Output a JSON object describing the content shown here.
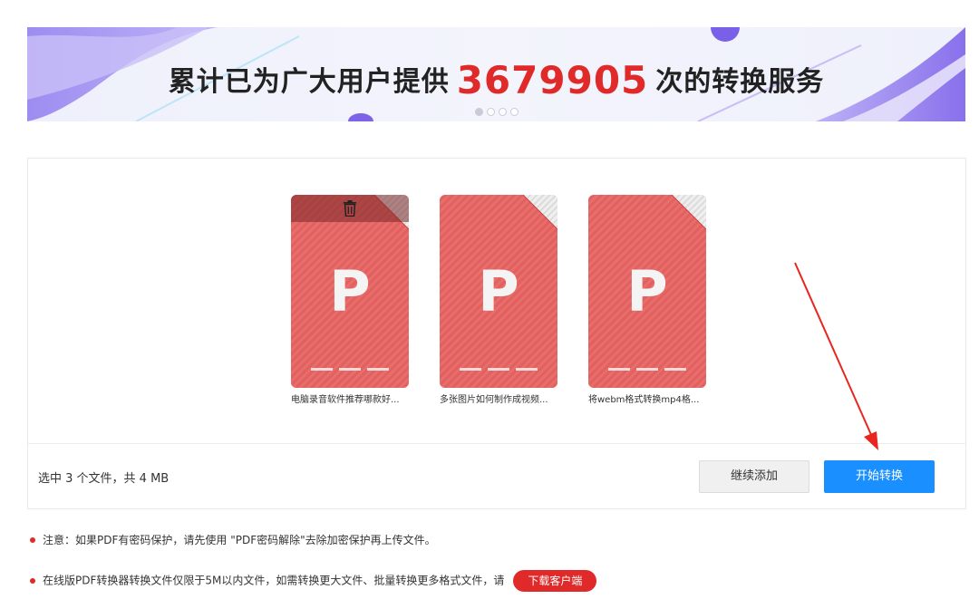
{
  "banner": {
    "prefix": "累计已为广大用户提供",
    "count": "3679905",
    "suffix": "次的转换服务"
  },
  "files": [
    {
      "name": "电脑录音软件推荐哪款好...",
      "letter": "P",
      "hovered": true
    },
    {
      "name": "多张图片如何制作成视频...",
      "letter": "P",
      "hovered": false
    },
    {
      "name": "将webm格式转换mp4格...",
      "letter": "P",
      "hovered": false
    }
  ],
  "summary": "选中 3 个文件，共 4 MB",
  "buttons": {
    "continue_add": "继续添加",
    "start_convert": "开始转换"
  },
  "notes": {
    "note1": "注意：如果PDF有密码保护，请先使用 \"PDF密码解除\"去除加密保护再上传文件。",
    "note2": "在线版PDF转换器转换文件仅限于5M以内文件，如需转换更大文件、批量转换更多格式文件，请",
    "download_button": "下载客户端"
  },
  "icons": {
    "trash": "trash-icon",
    "arrow": "red-arrow-annotation"
  },
  "colors": {
    "accent_red": "#e02a2a",
    "primary_blue": "#1a8fff",
    "file_red": "#e4605e"
  }
}
